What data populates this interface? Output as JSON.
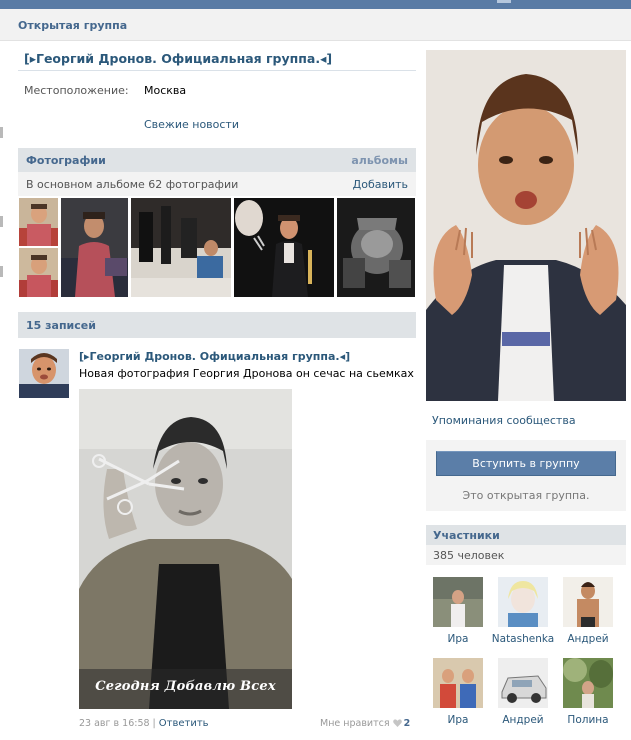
{
  "header": {
    "title": "Открытая группа"
  },
  "group": {
    "name": "[▸Георгий Дронов. Официальная группа.◂]",
    "location_label": "Местоположение:",
    "location_value": "Москва",
    "news_link": "Свежие новости"
  },
  "photos": {
    "title": "Фотографии",
    "albums_link": "альбомы",
    "subtitle": "В основном альбоме 62 фотографии",
    "add_link": "Добавить"
  },
  "wall": {
    "title": "15 записей"
  },
  "post": {
    "author": "[▸Георгий Дронов. Официальная группа.◂]",
    "text": "Новая фотография Георгия Дронова он сечас на сьемках",
    "photo_caption": "Сегодня Добавлю Всех",
    "date": "23 авг в 16:58",
    "separator": "|",
    "reply_link": "Ответить",
    "likes_label": "Мне нравится",
    "likes_count": "2"
  },
  "sidebar": {
    "mentions_link": "Упоминания сообщества",
    "join_button": "Вступить в группу",
    "open_group_note": "Это открытая группа.",
    "members_title": "Участники",
    "members_count": "385 человек",
    "members": [
      {
        "name": "Ира"
      },
      {
        "name": "Natashenka"
      },
      {
        "name": "Андрей"
      },
      {
        "name": "Ира"
      },
      {
        "name": "Андрей"
      },
      {
        "name": "Полина"
      }
    ]
  },
  "colors": {
    "brand_blue": "#597ba5",
    "link_blue": "#2b587a",
    "header_gray": "#dfe3e6",
    "button_blue": "#5b7ea8"
  },
  "icons": {
    "like": "heart-icon"
  }
}
